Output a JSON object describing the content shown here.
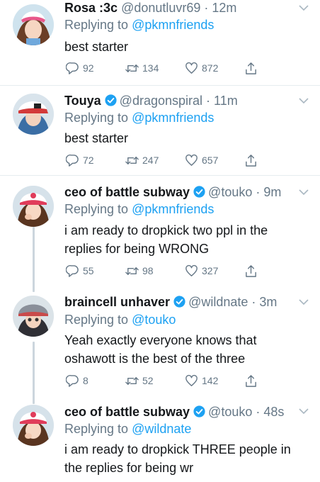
{
  "tweets": [
    {
      "name": "Rosa :3c",
      "handle": "@donutluvr69",
      "time": "12m",
      "verified": false,
      "replying_prefix": "Replying to",
      "replying_to": "@pkmnfriends",
      "text": "best starter",
      "replies": "92",
      "retweets": "134",
      "likes": "872"
    },
    {
      "name": "Touya",
      "handle": "@dragonspiral",
      "time": "11m",
      "verified": true,
      "replying_prefix": "Replying to",
      "replying_to": "@pkmnfriends",
      "text": "best starter",
      "replies": "72",
      "retweets": "247",
      "likes": "657"
    },
    {
      "name": "ceo of battle subway",
      "handle": "@touko",
      "time": "9m",
      "verified": true,
      "replying_prefix": "Replying to",
      "replying_to": "@pkmnfriends",
      "text": "i am ready to dropkick two ppl in the replies for being WRONG",
      "replies": "55",
      "retweets": "98",
      "likes": "327"
    },
    {
      "name": "braincell unhaver",
      "handle": "@wildnate",
      "time": "3m",
      "verified": true,
      "replying_prefix": "Replying to",
      "replying_to": "@touko",
      "text": "Yeah exactly everyone knows that oshawott is the best of the three",
      "replies": "8",
      "retweets": "52",
      "likes": "142"
    },
    {
      "name": "ceo of battle subway",
      "handle": "@touko",
      "time": "48s",
      "verified": true,
      "replying_prefix": "Replying to",
      "replying_to": "@wildnate",
      "text": "i am ready to dropkick THREE people in the replies for being wr"
    }
  ],
  "icons": {
    "reply": "reply-icon",
    "retweet": "retweet-icon",
    "like": "heart-icon",
    "share": "share-icon",
    "verified": "verified-badge-icon",
    "caret": "chevron-down-icon"
  },
  "colors": {
    "link": "#1da1f2",
    "muted": "#657786",
    "text": "#14171a",
    "divider": "#e6ecf0",
    "thread_line": "#ccd6dd"
  }
}
